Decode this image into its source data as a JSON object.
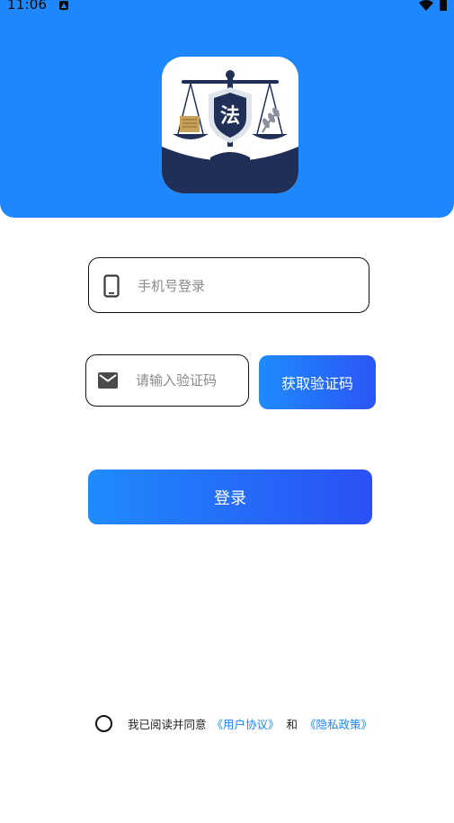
{
  "status_bar": {
    "time": "11:06"
  },
  "colors": {
    "header": "#1e87fb",
    "button_start": "#1f8bfc",
    "button_end": "#2a55f6",
    "link": "#1e87fb",
    "logo_navy": "#1f2f57"
  },
  "logo": {
    "emblem_text": "法"
  },
  "phone": {
    "placeholder": "手机号登录",
    "value": "",
    "icon": "smartphone-icon"
  },
  "code": {
    "placeholder": "请输入验证码",
    "value": "",
    "icon": "mail-icon"
  },
  "get_code_label": "获取验证码",
  "login_label": "登录",
  "agreement": {
    "checked": false,
    "prefix": "我已阅读并同意",
    "user_agreement": "《用户协议》",
    "conjunction": "和",
    "privacy_policy": "《隐私政策》"
  }
}
